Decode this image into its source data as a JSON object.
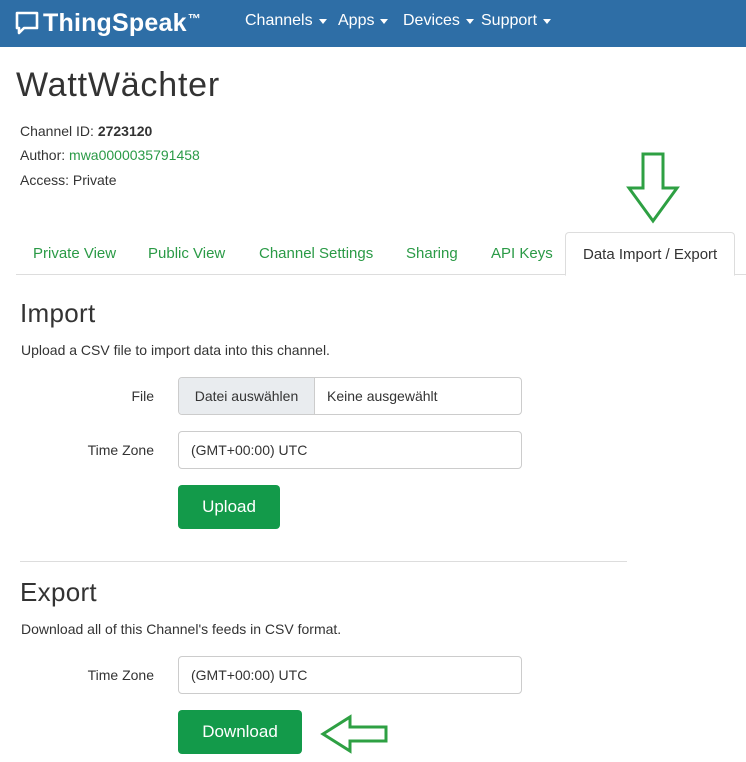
{
  "navbar": {
    "brand": "ThingSpeak",
    "brand_mark": "™",
    "items": [
      {
        "label": "Channels"
      },
      {
        "label": "Apps"
      },
      {
        "label": "Devices"
      },
      {
        "label": "Support"
      }
    ]
  },
  "channel": {
    "title": "WattWächter",
    "id_label": "Channel ID:",
    "id_value": "2723120",
    "author_label": "Author:",
    "author_value": "mwa0000035791458",
    "access_label": "Access:",
    "access_value": "Private"
  },
  "tabs": [
    {
      "label": "Private View"
    },
    {
      "label": "Public View"
    },
    {
      "label": "Channel Settings"
    },
    {
      "label": "Sharing"
    },
    {
      "label": "API Keys"
    },
    {
      "label": "Data Import / Export",
      "active": true
    }
  ],
  "import": {
    "title": "Import",
    "description": "Upload a CSV file to import data into this channel.",
    "file_label": "File",
    "file_button": "Datei auswählen",
    "file_status": "Keine ausgewählt",
    "timezone_label": "Time Zone",
    "timezone_value": "(GMT+00:00) UTC",
    "upload_button": "Upload"
  },
  "export": {
    "title": "Export",
    "description": "Download all of this Channel's feeds in CSV format.",
    "timezone_label": "Time Zone",
    "timezone_value": "(GMT+00:00) UTC",
    "download_button": "Download"
  },
  "colors": {
    "navbar": "#2e6ea6",
    "link": "#2a9a46",
    "button": "#139a4a",
    "annotation": "#2ea043"
  }
}
